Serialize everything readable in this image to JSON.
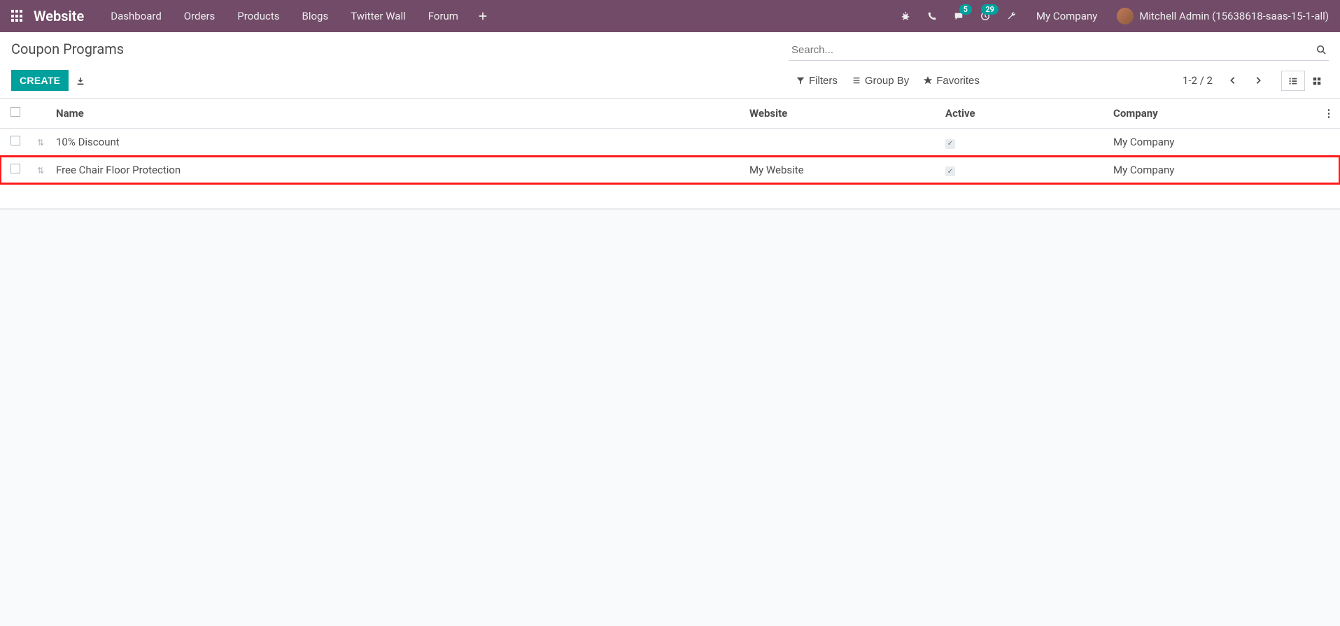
{
  "nav": {
    "brand": "Website",
    "menu": [
      "Dashboard",
      "Orders",
      "Products",
      "Blogs",
      "Twitter Wall",
      "Forum"
    ],
    "msg_badge": "5",
    "activity_badge": "29",
    "company": "My Company",
    "user": "Mitchell Admin (15638618-saas-15-1-all)"
  },
  "ctrl": {
    "title": "Coupon Programs",
    "create": "CREATE",
    "search_placeholder": "Search...",
    "filters": "Filters",
    "groupby": "Group By",
    "favorites": "Favorites",
    "pager": "1-2 / 2"
  },
  "table": {
    "headers": {
      "name": "Name",
      "website": "Website",
      "active": "Active",
      "company": "Company"
    },
    "rows": [
      {
        "name": "10% Discount",
        "website": "",
        "active": true,
        "company": "My Company",
        "highlight": false
      },
      {
        "name": "Free Chair Floor Protection",
        "website": "My Website",
        "active": true,
        "company": "My Company",
        "highlight": true
      }
    ]
  }
}
